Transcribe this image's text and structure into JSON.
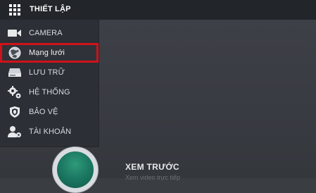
{
  "header": {
    "menu_icon": "grid-icon",
    "title": "THIẾT LẬP"
  },
  "sidebar": {
    "items": [
      {
        "label": "CAMERA",
        "icon": "camera-icon"
      },
      {
        "label": "Mạng lưới",
        "icon": "network-globe-icon",
        "selected": true
      },
      {
        "label": "LƯU TRỮ",
        "icon": "storage-drive-icon"
      },
      {
        "label": "HỆ THỐNG",
        "icon": "gears-icon"
      },
      {
        "label": "BẢO VỆ",
        "icon": "shield-icon"
      },
      {
        "label": "TÀI KHOẢN",
        "icon": "user-gear-icon"
      }
    ]
  },
  "preview": {
    "title": "XEM TRƯỚC",
    "subtitle": "Xem video trực tiếp"
  },
  "colors": {
    "selected_outline": "#d0121a",
    "header_bg": "#22252a",
    "sidebar_bg": "#2c2f35"
  }
}
